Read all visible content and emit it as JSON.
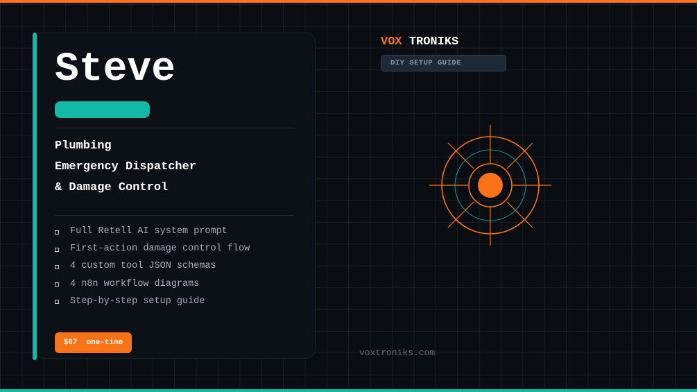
{
  "card": {
    "name": "Steve",
    "role_lines": [
      "Plumbing",
      "Emergency Dispatcher",
      "& Damage Control"
    ],
    "features": [
      "Full Retell AI system prompt",
      "First-action damage control flow",
      "4 custom tool JSON schemas",
      "4 n8n workflow diagrams",
      "Step-by-step setup guide"
    ],
    "price": "$67",
    "price_note": "one-time"
  },
  "brand": {
    "part1": "VOX",
    "part2": "TRONIKS",
    "badge": "DIY SETUP GUIDE"
  },
  "footer": {
    "url": "voxtroniks.com"
  },
  "colors": {
    "accent_orange": "#f97316",
    "accent_teal": "#14b8a6",
    "background": "#0a0d12",
    "card": "#0c1017"
  },
  "icons": {
    "target": "crosshair-target-icon",
    "bullet": "square-bullet-icon"
  }
}
